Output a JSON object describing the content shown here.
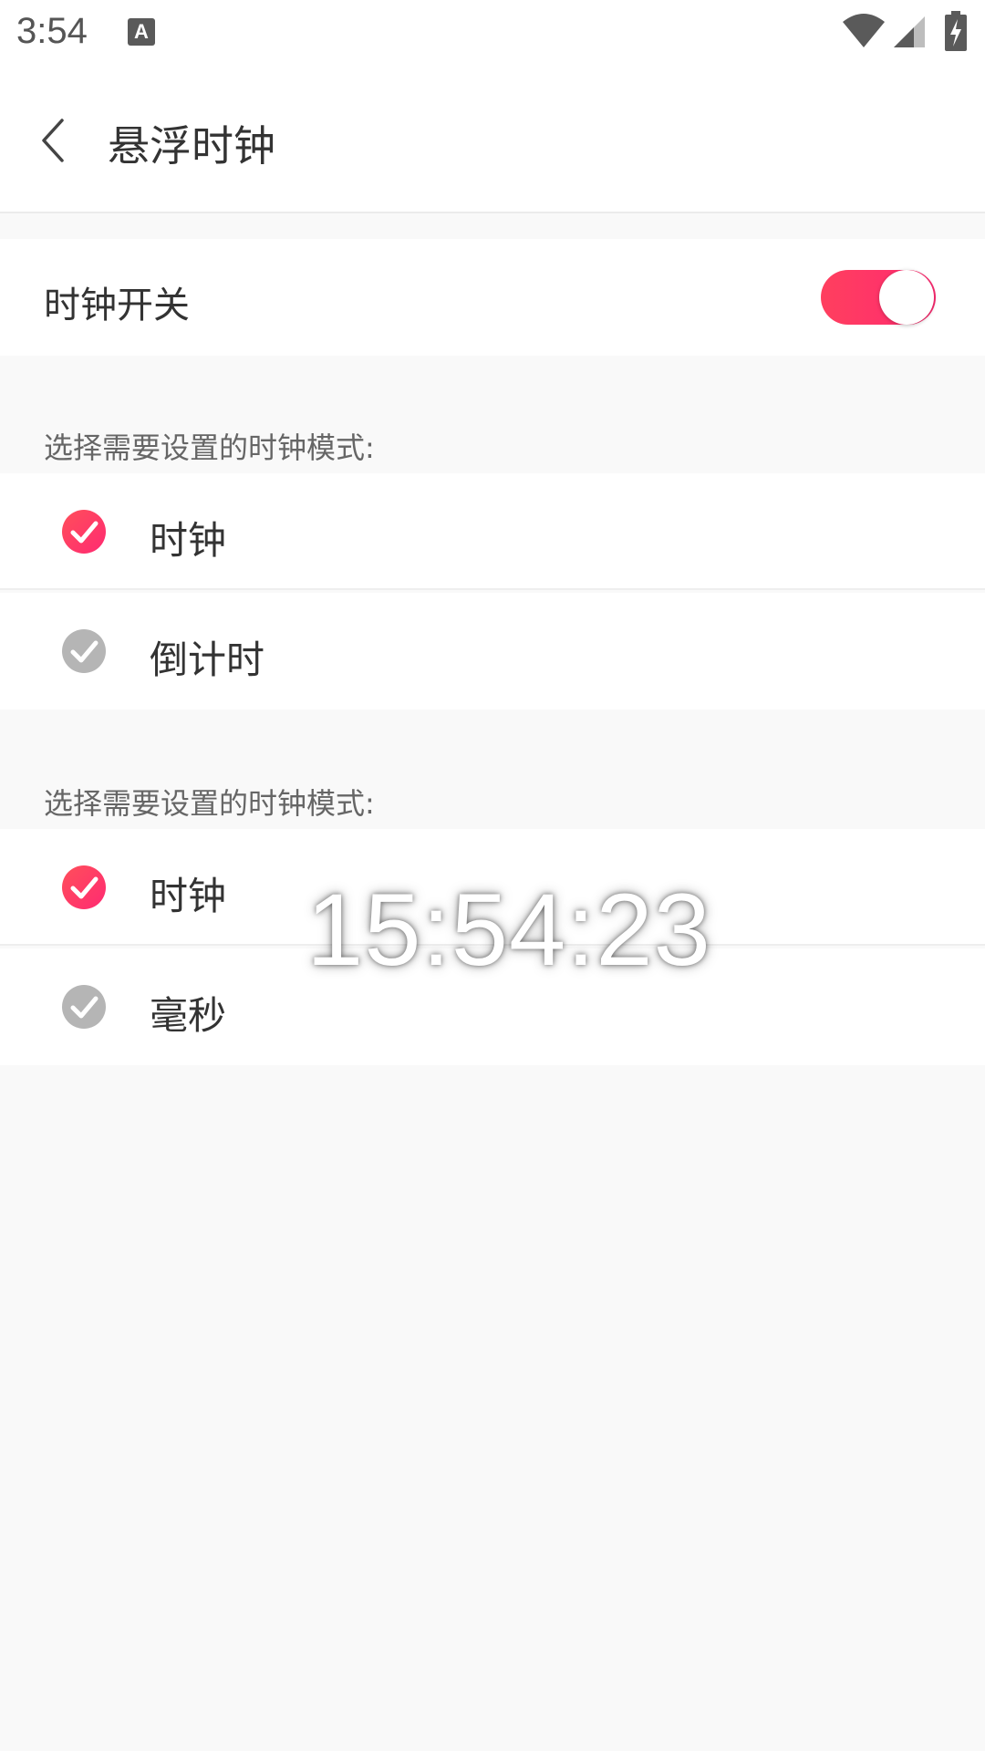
{
  "status_bar": {
    "time": "3:54",
    "notification_icon_letter": "A",
    "icons": [
      "a-notification-icon",
      "wifi-icon",
      "cell-signal-icon",
      "battery-charging-icon"
    ]
  },
  "header": {
    "title": "悬浮时钟",
    "back_icon": "chevron-left-icon"
  },
  "clock_switch": {
    "label": "时钟开关",
    "enabled": true
  },
  "section_mode": {
    "caption": "选择需要设置的时钟模式:",
    "options": [
      {
        "label": "时钟",
        "selected": true
      },
      {
        "label": "倒计时",
        "selected": false
      }
    ]
  },
  "section_format": {
    "caption": "选择需要设置的时钟模式:",
    "options": [
      {
        "label": "时钟",
        "selected": true
      },
      {
        "label": "毫秒",
        "selected": false
      }
    ]
  },
  "floating_clock": {
    "time": "15:54:23"
  },
  "colors": {
    "accent": "#ff2f66",
    "unselected_check": "#b5b5b5",
    "background": "#f9f9f9"
  }
}
